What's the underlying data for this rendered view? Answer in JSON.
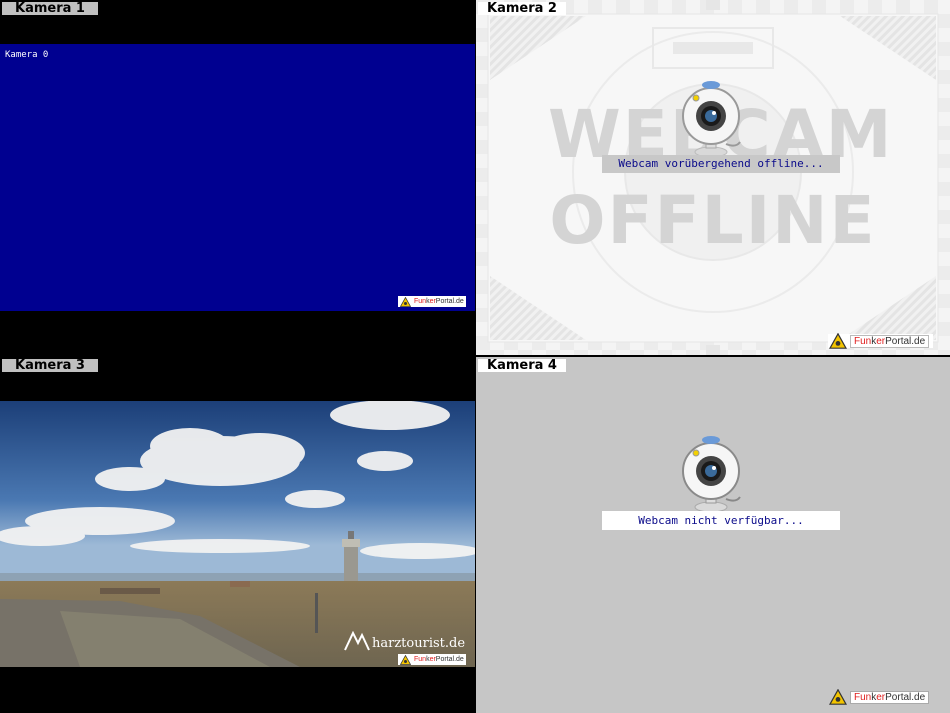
{
  "cameras": [
    {
      "label": "Kamera 1",
      "overlay_text": "Kamera 0",
      "bg_color": "#000090"
    },
    {
      "label": "Kamera 2",
      "status": "Webcam vorübergehend offline...",
      "watermark_top": "WEBCAM",
      "watermark_bottom": "OFFLINE"
    },
    {
      "label": "Kamera 3",
      "site_logo": "harztourist.de"
    },
    {
      "label": "Kamera 4",
      "status": "Webcam nicht verfügbar..."
    }
  ],
  "funkerportal": {
    "part1": "Fun",
    "part2": "k",
    "part3": "er",
    "part4": "Portal",
    "part5": ".de"
  },
  "icons": [
    "webcam-icon",
    "warning-triangle-icon",
    "harztourist-m-icon"
  ]
}
